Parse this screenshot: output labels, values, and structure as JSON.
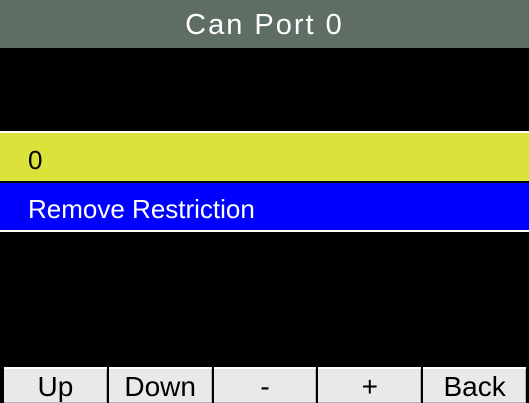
{
  "title": "Can Port 0",
  "menu": {
    "selected_value": "0",
    "option_label": "Remove Restriction"
  },
  "softkeys": {
    "up": "Up",
    "down": "Down",
    "minus": "-",
    "plus": "+",
    "back": "Back"
  },
  "colors": {
    "title_bar": "#5e6e65",
    "selected_row": "#dbe33a",
    "option_row": "#0000ff",
    "background": "#000000",
    "softkey": "#e9e9e9"
  }
}
